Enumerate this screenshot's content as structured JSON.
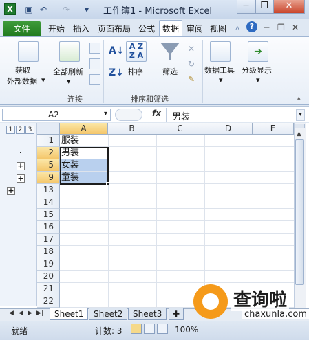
{
  "window": {
    "title": "工作簿1 - Microsoft Excel",
    "app_icon": "X",
    "minimize": "─",
    "restore": "❐",
    "close": "✕"
  },
  "ribbon": {
    "file_tab": "文件",
    "tabs": [
      "开始",
      "插入",
      "页面布局",
      "公式",
      "数据",
      "审阅",
      "视图"
    ],
    "active_tab": "数据",
    "groups": {
      "external": {
        "label1": "获取",
        "label2": "外部数据"
      },
      "connections": {
        "refresh_label": "全部刷新",
        "group_label": "连接"
      },
      "sortfilter": {
        "sort_label": "排序",
        "filter_label": "筛选",
        "group_label": "排序和筛选"
      },
      "datatools": {
        "label": "数据工具"
      },
      "outline": {
        "label": "分级显示"
      }
    }
  },
  "formula_bar": {
    "name_box": "A2",
    "fx": "fx",
    "value": "男装"
  },
  "outline": {
    "levels": [
      "1",
      "2",
      "3"
    ],
    "expand_symbol": "+"
  },
  "grid": {
    "columns": [
      "A",
      "B",
      "C",
      "D",
      "E"
    ],
    "selected_column": "A",
    "rows": [
      {
        "num": "1",
        "value": "服装",
        "selected": false
      },
      {
        "num": "2",
        "value": "男装",
        "selected": true
      },
      {
        "num": "5",
        "value": "女装",
        "selected": true
      },
      {
        "num": "9",
        "value": "童装",
        "selected": true
      },
      {
        "num": "13",
        "value": "",
        "selected": false
      },
      {
        "num": "14",
        "value": "",
        "selected": false
      },
      {
        "num": "15",
        "value": "",
        "selected": false
      },
      {
        "num": "16",
        "value": "",
        "selected": false
      },
      {
        "num": "17",
        "value": "",
        "selected": false
      },
      {
        "num": "18",
        "value": "",
        "selected": false
      },
      {
        "num": "19",
        "value": "",
        "selected": false
      },
      {
        "num": "20",
        "value": "",
        "selected": false
      },
      {
        "num": "21",
        "value": "",
        "selected": false
      },
      {
        "num": "22",
        "value": "",
        "selected": false
      }
    ]
  },
  "sheets": {
    "tabs": [
      "Sheet1",
      "Sheet2",
      "Sheet3"
    ],
    "active": "Sheet1"
  },
  "status": {
    "ready": "就绪",
    "count": "计数: 3",
    "zoom": "100%"
  },
  "watermark": {
    "text": "查询啦",
    "url": "chaxunla.com"
  }
}
